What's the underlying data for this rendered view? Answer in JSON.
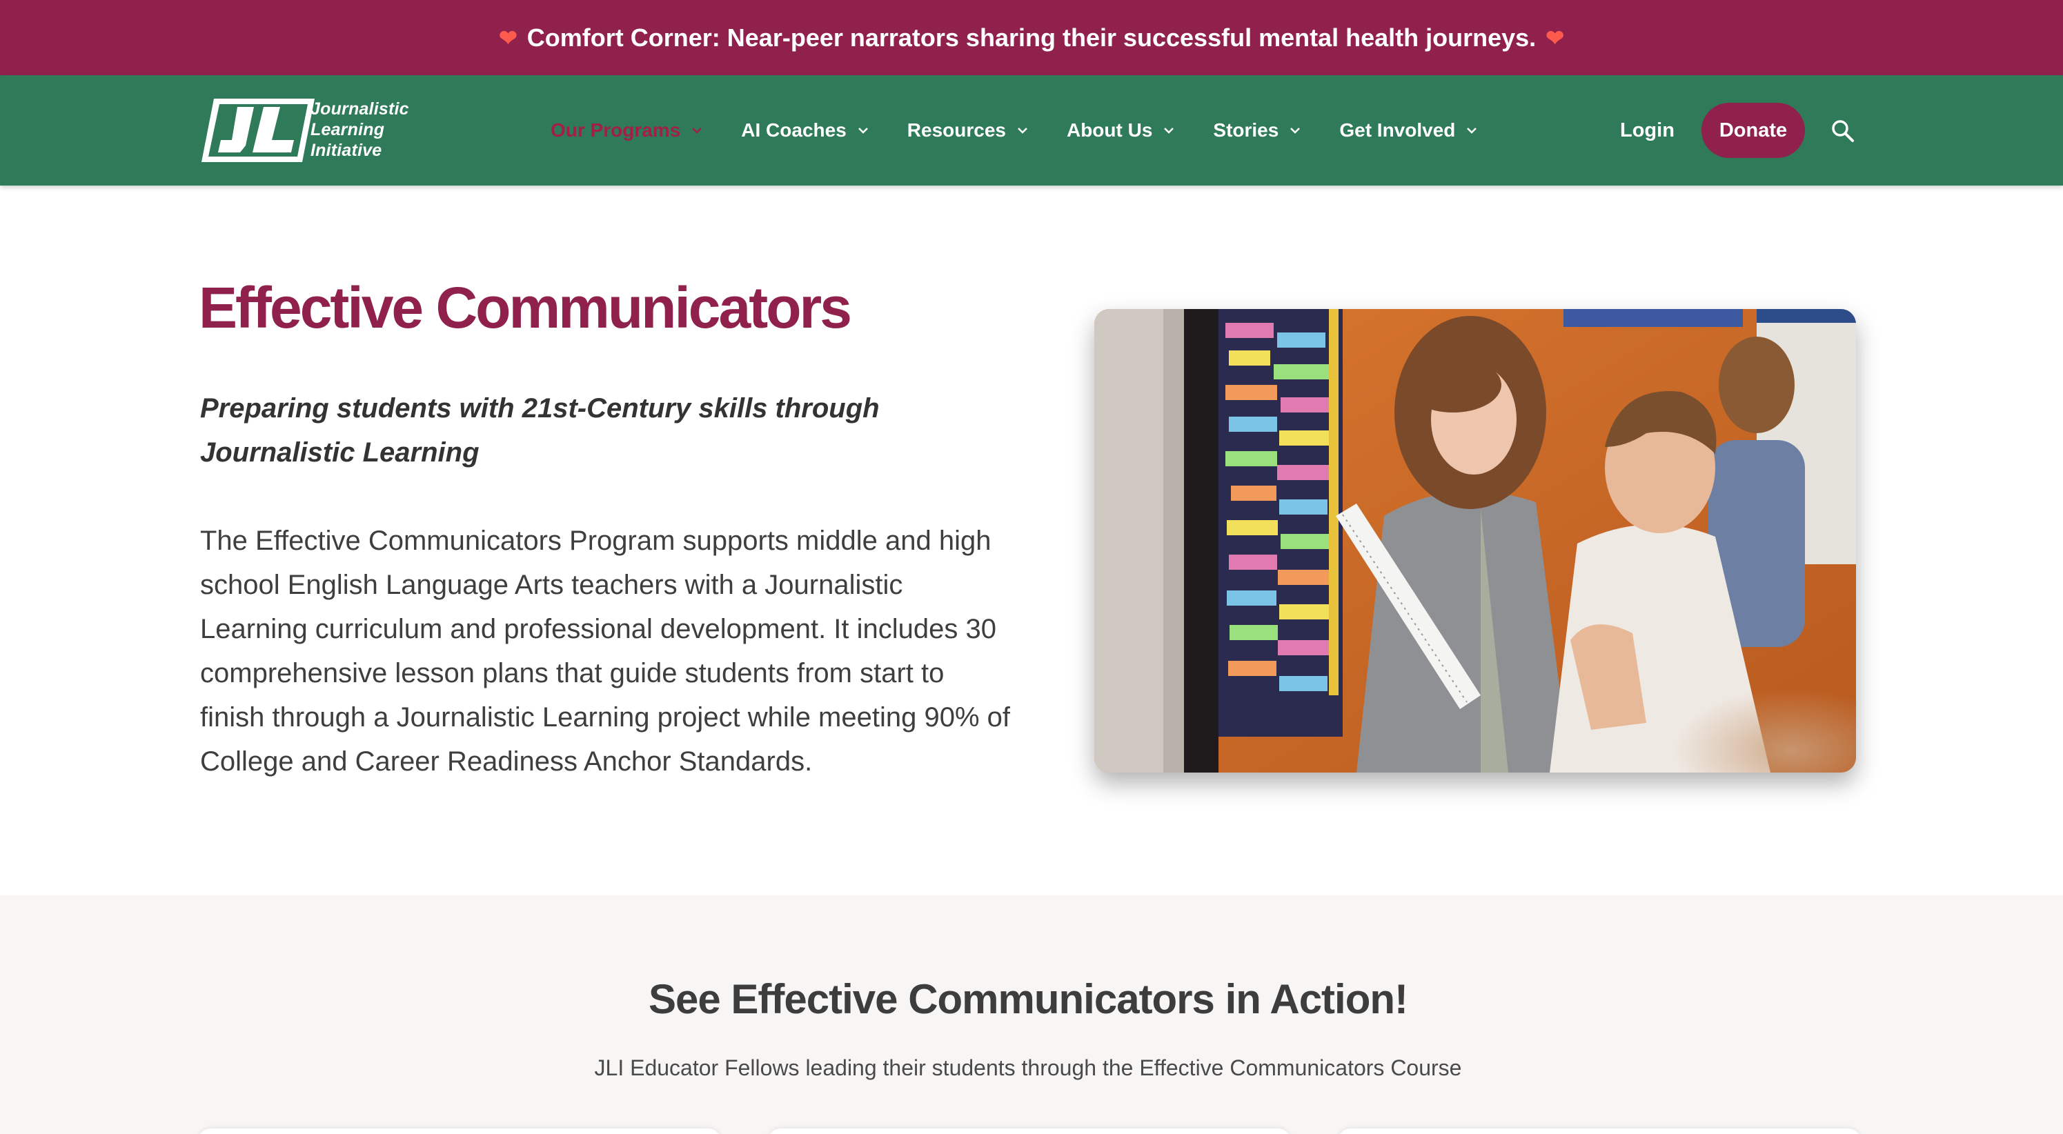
{
  "announcement": {
    "text": "Comfort Corner: Near-peer narrators sharing their successful mental health journeys.",
    "icon_left": "heart-icon",
    "icon_right": "heart-icon",
    "heart_glyph": "❤"
  },
  "logo": {
    "mark": "JL",
    "lines": [
      "Journalistic",
      "Learning",
      "Initiative"
    ]
  },
  "nav": {
    "items": [
      {
        "label": "Our Programs",
        "active": true
      },
      {
        "label": "AI Coaches"
      },
      {
        "label": "Resources"
      },
      {
        "label": "About Us"
      },
      {
        "label": "Stories"
      },
      {
        "label": "Get Involved"
      }
    ],
    "login_label": "Login",
    "donate_label": "Donate",
    "search_icon": "search-icon"
  },
  "hero": {
    "title": "Effective Communicators",
    "subtitle": "Preparing students with 21st-Century skills through Journalistic Learning",
    "body": "The Effective Communicators Program supports middle and high school English Language Arts teachers with a Journalistic Learning curriculum and professional development. It includes 30 comprehensive lesson plans that guide students from start to finish through a Journalistic Learning project while meeting 90% of College and Career Readiness Anchor Standards."
  },
  "section2": {
    "title": "See Effective Communicators in Action!",
    "subtitle": "JLI Educator Fellows leading their students through the Effective Communicators Course"
  },
  "colors": {
    "banner": "#8f214c",
    "header": "#2f7a58",
    "accent": "#8f214c",
    "active_nav": "#a31f48",
    "section_bg": "#f8f5f5"
  }
}
